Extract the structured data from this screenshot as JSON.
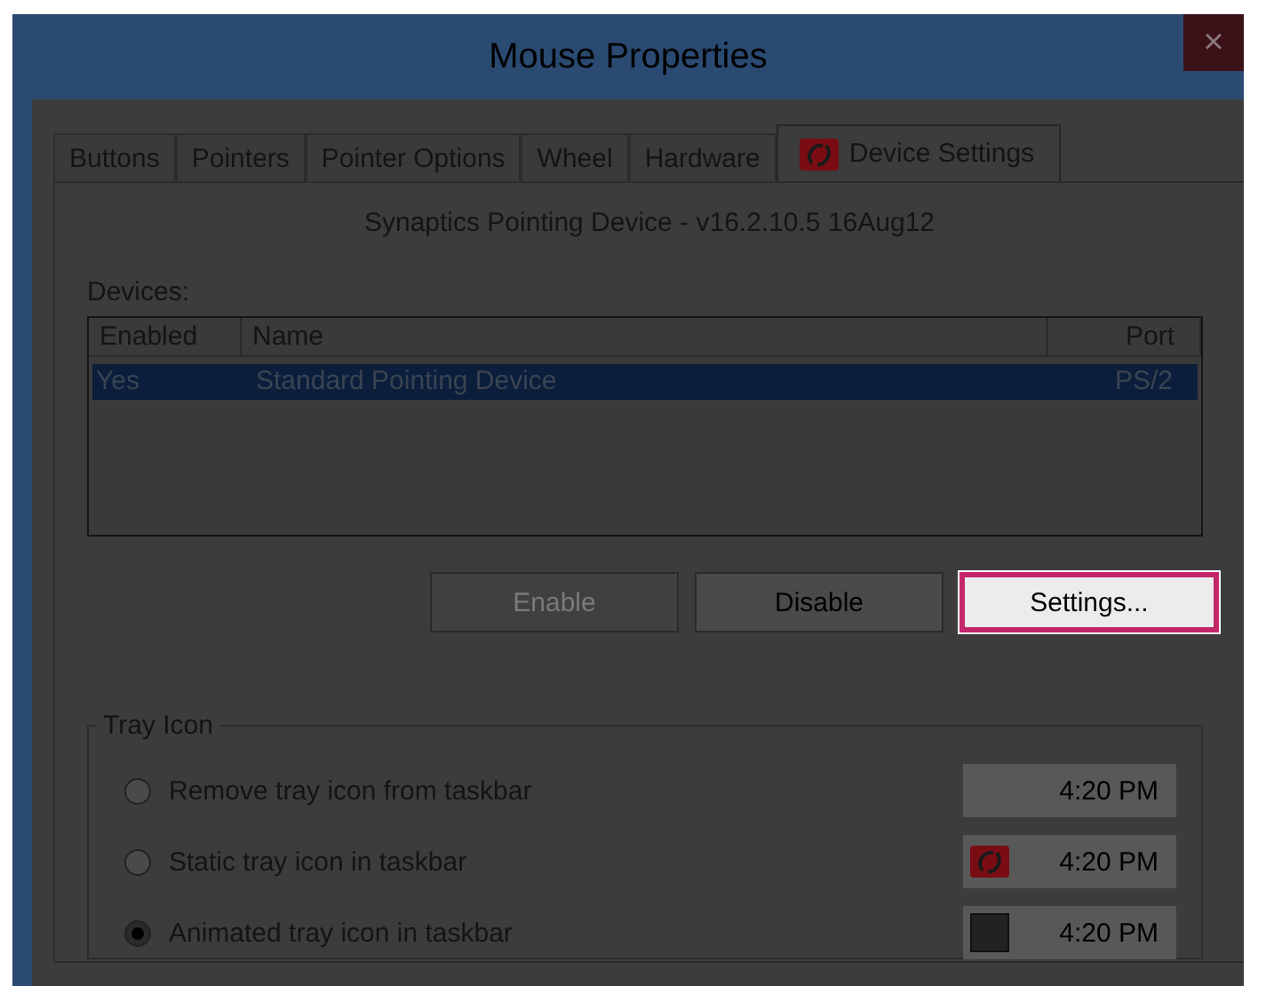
{
  "window": {
    "title": "Mouse Properties",
    "close": "×"
  },
  "tabs": [
    {
      "label": "Buttons",
      "selected": false,
      "kind": "plain"
    },
    {
      "label": "Pointers",
      "selected": false,
      "kind": "plain"
    },
    {
      "label": "Pointer Options",
      "selected": false,
      "kind": "plain"
    },
    {
      "label": "Wheel",
      "selected": false,
      "kind": "plain"
    },
    {
      "label": "Hardware",
      "selected": false,
      "kind": "plain"
    },
    {
      "label": "Device Settings",
      "selected": true,
      "kind": "device"
    }
  ],
  "device_info": "Synaptics Pointing Device - v16.2.10.5 16Aug12",
  "devices": {
    "label": "Devices:",
    "columns": [
      "Enabled",
      "Name",
      "Port"
    ],
    "rows": [
      {
        "cells": [
          "Yes",
          "Standard Pointing Device",
          "PS/2"
        ],
        "selected": true
      }
    ]
  },
  "buttons": [
    {
      "label": "Enable",
      "disabled": true,
      "highlighted": false
    },
    {
      "label": "Disable",
      "disabled": false,
      "highlighted": false
    },
    {
      "label": "Settings...",
      "disabled": false,
      "highlighted": true
    }
  ],
  "tray_icon": {
    "title": "Tray Icon",
    "options": [
      {
        "label": "Remove tray icon from taskbar",
        "selected": false,
        "kind": "plain",
        "time": "4:20 PM"
      },
      {
        "label": "Static tray icon in taskbar",
        "selected": false,
        "kind": "static",
        "time": "4:20 PM"
      },
      {
        "label": "Animated tray icon in taskbar",
        "selected": true,
        "kind": "animated",
        "time": "4:20 PM"
      }
    ]
  }
}
